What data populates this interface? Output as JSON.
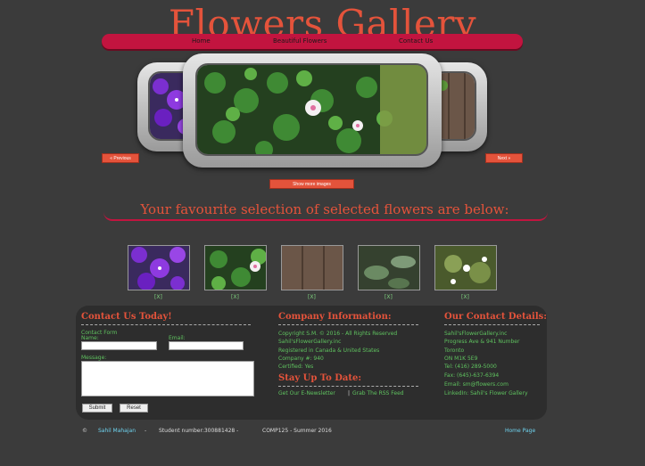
{
  "site": {
    "title": "Flowers Gallery"
  },
  "nav": {
    "home": "Home",
    "beautiful": "Beautiful Flowers",
    "contact": "Contact Us"
  },
  "slider": {
    "prev": "« Previous",
    "next": "Next »",
    "show_more": "Show more images"
  },
  "section": {
    "heading": "Your favourite selection of selected flowers are below:"
  },
  "thumbs": {
    "mark": "[X]"
  },
  "contact_form": {
    "title": "Contact Us Today!",
    "form_label": "Contact Form",
    "name_label": "Name:",
    "email_label": "Email:",
    "message_label": "Message:",
    "submit": "Submit",
    "reset": "Reset"
  },
  "company": {
    "title": "Company Information:",
    "lines": [
      "Copyright S.M. © 2016 - All Rights Reserved",
      "Sahil'sFlowerGallery.inc",
      "Registered in Canada & United States",
      "Company #: 940",
      "Certified: Yes"
    ],
    "stay_title": "Stay Up To Date:",
    "newsletter": "Get Our E-Newsletter",
    "separator": "|",
    "rss": "Grab The RSS Feed"
  },
  "details": {
    "title": "Our Contact Details:",
    "lines": [
      "Sahil'sFlowerGallery.inc",
      "Progress Ave & 941 Number",
      "Toronto",
      "ON M1K 5E9",
      "Tel: (416) 289-5000",
      "Fax: (645)-637-6394",
      "Email: sm@flowers.com",
      "LinkedIn: Sahil's Flower Gallery"
    ]
  },
  "bottom": {
    "copyright": "©",
    "author": "Sahil Mahajan",
    "dash": "-",
    "student": "Student number:300881428 -",
    "course": "COMP125 - Summer 2016",
    "home_link": "Home Page"
  },
  "colors": {
    "accent": "#e4533b",
    "nav_bar": "#c2143f",
    "link_green": "#5fc25f",
    "background": "#3b3b3b"
  }
}
